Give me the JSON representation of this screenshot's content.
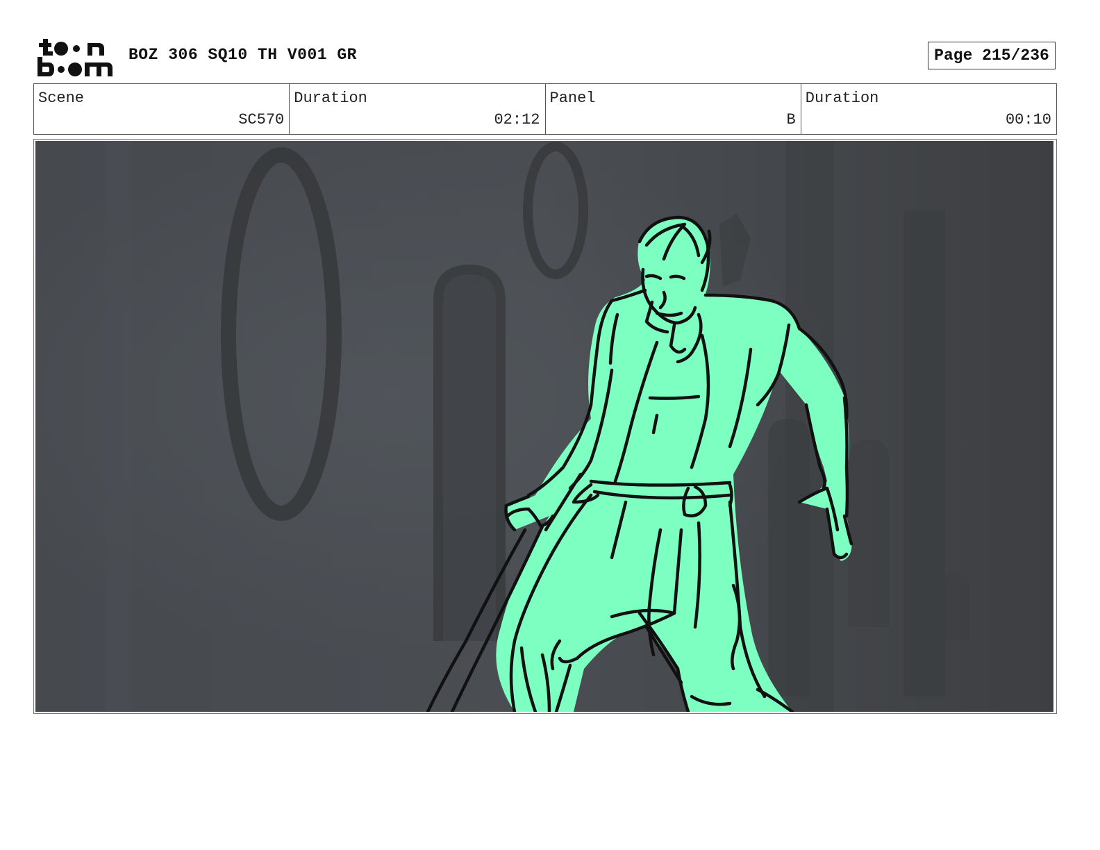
{
  "header": {
    "brand": "toon boom",
    "title": "BOZ 306 SQ10 TH V001 GR",
    "page": "Page 215/236"
  },
  "info": {
    "scene_label": "Scene",
    "scene_value": "SC570",
    "scene_duration_label": "Duration",
    "scene_duration_value": "02:12",
    "panel_label": "Panel",
    "panel_value": "B",
    "panel_duration_label": "Duration",
    "panel_duration_value": "00:10"
  },
  "colors": {
    "character_fill": "#7dffc2",
    "background": "#44474b",
    "line": "#111111"
  }
}
